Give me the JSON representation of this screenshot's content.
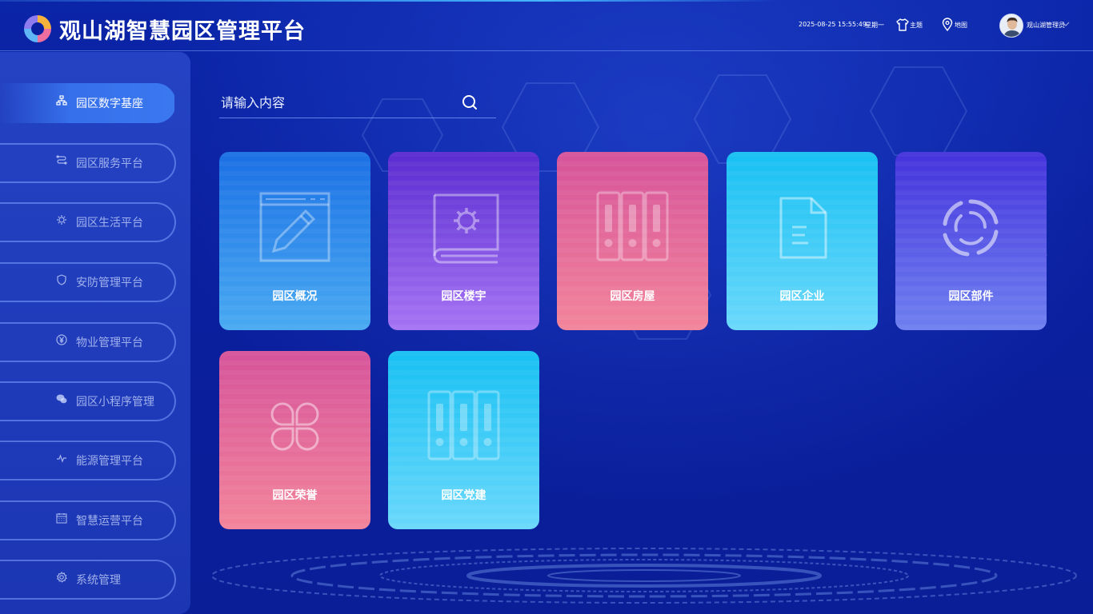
{
  "header": {
    "title": "观山湖智慧园区管理平台",
    "datetime": "2025-08-25 15:55:49",
    "weekday": "星期一",
    "theme_label": "主题",
    "map_label": "地图",
    "username": "观山湖管理员"
  },
  "search": {
    "placeholder": "请输入内容"
  },
  "sidebar": {
    "items": [
      {
        "label": "园区数字基座",
        "icon": "network-icon",
        "active": true
      },
      {
        "label": "园区服务平台",
        "icon": "route-icon",
        "active": false
      },
      {
        "label": "园区生活平台",
        "icon": "gear-flower-icon",
        "active": false
      },
      {
        "label": "安防管理平台",
        "icon": "shield-icon",
        "active": false
      },
      {
        "label": "物业管理平台",
        "icon": "yen-icon",
        "active": false
      },
      {
        "label": "园区小程序管理",
        "icon": "wechat-icon",
        "active": false
      },
      {
        "label": "能源管理平台",
        "icon": "pulse-icon",
        "active": false
      },
      {
        "label": "智慧运营平台",
        "icon": "calendar-icon",
        "active": false
      },
      {
        "label": "系统管理",
        "icon": "settings-icon",
        "active": false
      }
    ]
  },
  "cards": [
    {
      "label": "园区概况",
      "icon": "edit-window-icon",
      "color": "#1a6fe4"
    },
    {
      "label": "园区楼宇",
      "icon": "book-gear-icon",
      "color": "#5a2bd0"
    },
    {
      "label": "园区房屋",
      "icon": "binders-icon",
      "color": "#d6539a"
    },
    {
      "label": "园区企业",
      "icon": "document-icon",
      "color": "#17c0f3"
    },
    {
      "label": "园区部件",
      "icon": "swirl-icon",
      "color": "#4432dc"
    },
    {
      "label": "园区荣誉",
      "icon": "clover-icon",
      "color": "#d6539a"
    },
    {
      "label": "园区党建",
      "icon": "binders-icon",
      "color": "#17c0f3"
    }
  ],
  "colors": {
    "background": "#0a1f9e",
    "accent": "#3a78f0"
  }
}
